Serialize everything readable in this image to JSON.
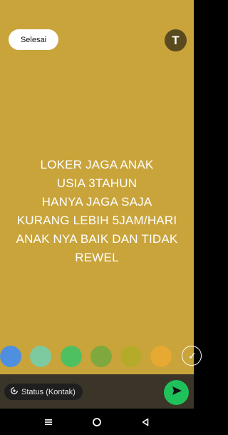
{
  "header": {
    "done_label": "Selesai",
    "text_tool_label": "T"
  },
  "status": {
    "lines": [
      "LOKER JAGA ANAK",
      "USIA 3TAHUN",
      "HANYA JAGA SAJA",
      "KURANG LEBIH 5JAM/HARI",
      "ANAK NYA BAIK DAN TIDAK",
      "REWEL"
    ],
    "background_color": "#c9a43b"
  },
  "palette": {
    "colors": [
      "#4f8fe0",
      "#7ecaa0",
      "#4fc062",
      "#7fa93e",
      "#b4ab2a",
      "#e6a931"
    ],
    "selected_color": "#c9a43b"
  },
  "footer": {
    "privacy_label": "Status (Kontak)",
    "send_icon": "send-icon"
  },
  "nav": {
    "icons": [
      "recent-apps-icon",
      "home-icon",
      "back-icon"
    ]
  }
}
